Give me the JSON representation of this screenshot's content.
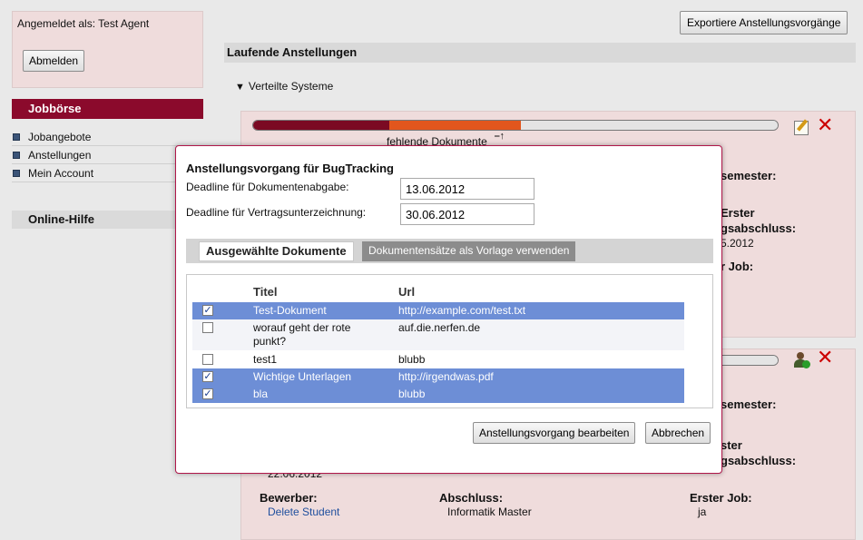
{
  "sidebar": {
    "logged_in_text": "Angemeldet als: Test Agent",
    "logout_label": "Abmelden",
    "section_title": "Jobbörse",
    "items": [
      {
        "label": "Jobangebote"
      },
      {
        "label": "Anstellungen"
      },
      {
        "label": "Mein Account"
      }
    ],
    "help_title": "Online-Hilfe"
  },
  "main": {
    "export_label": "Exportiere Anstellungsvorgänge",
    "header": "Laufende Anstellungen",
    "group_title": "Verteilte Systeme",
    "card1": {
      "progress_label": "fehlende Dokumente",
      "progress": {
        "dark": 0.26,
        "orange": 0.25,
        "gray": 0.49
      },
      "partial_labels": [
        "semester:",
        "Erster",
        "gsabschluss:",
        "5.2012",
        "r Job:"
      ]
    },
    "card2": {
      "partial_labels": [
        "semester:",
        "ster",
        "gsabschluss:"
      ],
      "partial_date": "22.06.2012",
      "applicant_label": "Bewerber:",
      "applicant_value": "Delete Student",
      "degree_label": "Abschluss:",
      "degree_value": "Informatik Master",
      "first_job_label": "Erster Job:",
      "first_job_value": "ja"
    }
  },
  "modal": {
    "title": "Anstellungsvorgang für BugTracking",
    "deadline_docs_label": "Deadline für Dokumentenabgabe:",
    "deadline_docs_value": "13.06.2012",
    "deadline_contract_label": "Deadline für Vertragsunterzeichnung:",
    "deadline_contract_value": "30.06.2012",
    "tabs": [
      {
        "label": "Ausgewählte Dokumente"
      },
      {
        "label": "Dokumentensätze als Vorlage verwenden"
      }
    ],
    "columns": {
      "title": "Titel",
      "url": "Url"
    },
    "rows": [
      {
        "title": "Test-Dokument",
        "url": "http://example.com/test.txt",
        "checked": true
      },
      {
        "title": "worauf geht der rote punkt?",
        "url": "auf.die.nerfen.de",
        "checked": false
      },
      {
        "title": "test1",
        "url": "blubb",
        "checked": false
      },
      {
        "title": "Wichtige Unterlagen",
        "url": "http://irgendwas.pdf",
        "checked": true
      },
      {
        "title": "bla",
        "url": "blubb",
        "checked": true
      }
    ],
    "edit_button": "Anstellungsvorgang bearbeiten",
    "cancel_button": "Abbrechen"
  },
  "colors": {
    "brand": "#8b0a2c",
    "selection": "#6d8ed6",
    "card_bg": "#efdcdc",
    "progress_orange": "#e2561d"
  },
  "icons": [
    "edit-icon",
    "close-icon",
    "add-user-icon",
    "triangle-down-icon",
    "checkbox-icon"
  ]
}
